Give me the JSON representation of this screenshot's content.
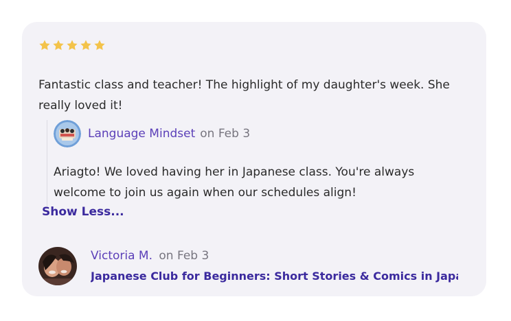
{
  "review": {
    "rating": 5,
    "star_color": "#f3c34a",
    "text": "Fantastic class and teacher! The highlight of my daughter's week. She really loved it!"
  },
  "reply": {
    "author": "Language Mindset",
    "date": "on Feb 3",
    "text": "Ariagto! We loved having her in Japanese class. You're always welcome to join us again when our schedules align!"
  },
  "toggle": {
    "label": "Show Less..."
  },
  "reviewer": {
    "name": "Victoria M.",
    "date": "on Feb 3",
    "class_title": "Japanese Club for Beginners: Short Stories & Comics in Japanese"
  },
  "colors": {
    "card_bg": "#f3f2f7",
    "link_purple": "#5b3fb8",
    "dark_purple": "#3b2a9e",
    "muted_text": "#77757f"
  },
  "icons": {
    "star": "star-icon",
    "teacher_avatar": "teacher-avatar",
    "reviewer_avatar": "reviewer-avatar"
  }
}
